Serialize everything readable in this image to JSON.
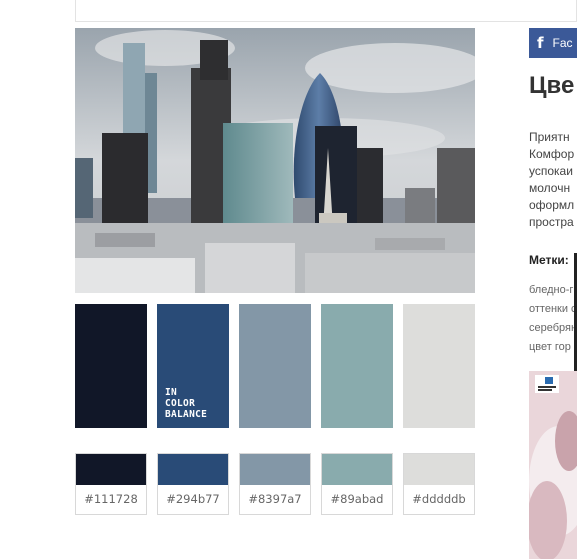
{
  "sidebar": {
    "facebook_label": "Fac",
    "heading": "Цве",
    "paragraph_lines": [
      "Приятн",
      "Комфор",
      "успокаи",
      "молочн",
      "оформл",
      "простра"
    ],
    "tags_title": "Метки:",
    "tag_lines": [
      "бледно-г",
      "оттенки с",
      "серебрян",
      "цвет гор"
    ]
  },
  "palette": {
    "caption": "IN\nCOLOR\nBALANCE",
    "colors": [
      {
        "hex": "#111728",
        "code": "#111728"
      },
      {
        "hex": "#294b77",
        "code": "#294b77"
      },
      {
        "hex": "#8397a7",
        "code": "#8397a7"
      },
      {
        "hex": "#89abad",
        "code": "#89abad"
      },
      {
        "hex": "#dddddb",
        "code": "#dddddb"
      }
    ]
  },
  "colors": {
    "facebook": "#3b5998"
  }
}
